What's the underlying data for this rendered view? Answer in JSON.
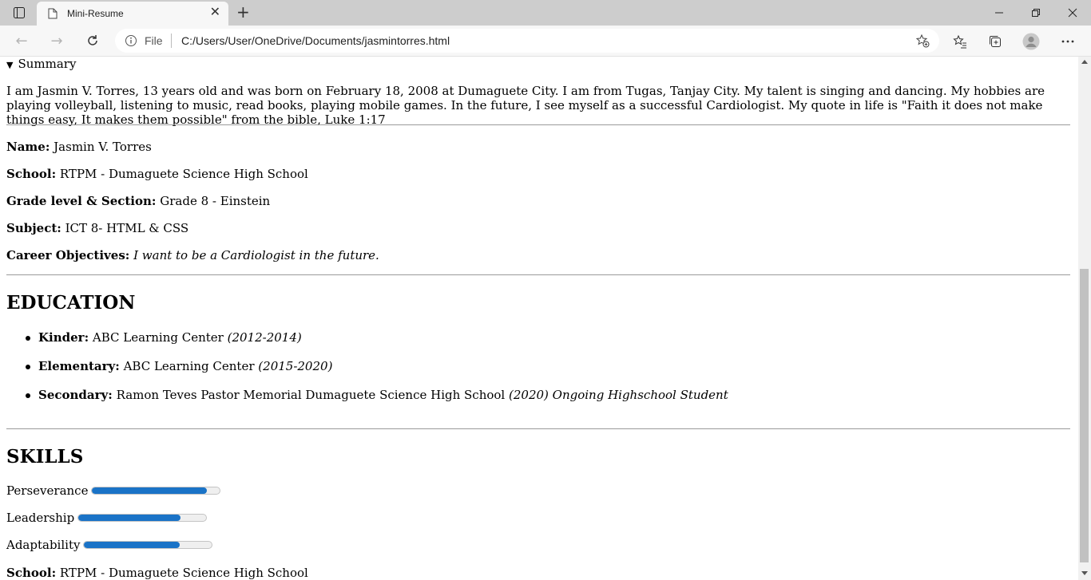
{
  "browser": {
    "tab_title": "Mini-Resume",
    "address_prefix": "File",
    "url": "C:/Users/User/OneDrive/Documents/jasmintorres.html"
  },
  "page": {
    "summary_label": "Summary",
    "summary_text": "I am Jasmin V. Torres, 13 years old and was born on February 18, 2008 at Dumaguete City. I am from Tugas, Tanjay City. My talent is singing and dancing. My hobbies are playing volleyball, listening to music, read books, playing mobile games. In the future, I see myself as a successful Cardiologist. My quote in life is \"Faith it does not make things easy, It makes them possible\" from the bible, Luke 1:17",
    "info": [
      {
        "label": "Name:",
        "value": "Jasmin V. Torres"
      },
      {
        "label": "School:",
        "value": "RTPM - Dumaguete Science High School"
      },
      {
        "label": "Grade level & Section:",
        "value": "Grade 8 - Einstein"
      },
      {
        "label": "Subject:",
        "value": "ICT 8- HTML & CSS"
      },
      {
        "label": "Career Objectives:",
        "value": "I want to be a Cardiologist in the future."
      }
    ],
    "education_heading": "EDUCATION",
    "education": [
      {
        "label": "Kinder:",
        "school": "ABC Learning Center",
        "note": "(2012-2014)"
      },
      {
        "label": "Elementary:",
        "school": "ABC Learning Center",
        "note": "(2015-2020)"
      },
      {
        "label": "Secondary:",
        "school": "Ramon Teves Pastor Memorial Dumaguete Science High School",
        "note": "(2020) Ongoing Highschool Student"
      }
    ],
    "skills_heading": "SKILLS",
    "skills": [
      {
        "name": "Perseverance",
        "level": 0.9
      },
      {
        "name": "Leadership",
        "level": 0.8
      },
      {
        "name": "Adaptability",
        "level": 0.75
      }
    ],
    "footer_label": "School:",
    "footer_value": "RTPM - Dumaguete Science High School"
  },
  "colors": {
    "accent": "#1a73c7",
    "tabbar": "#cdcdcd",
    "toolbar": "#f7f7f7"
  }
}
